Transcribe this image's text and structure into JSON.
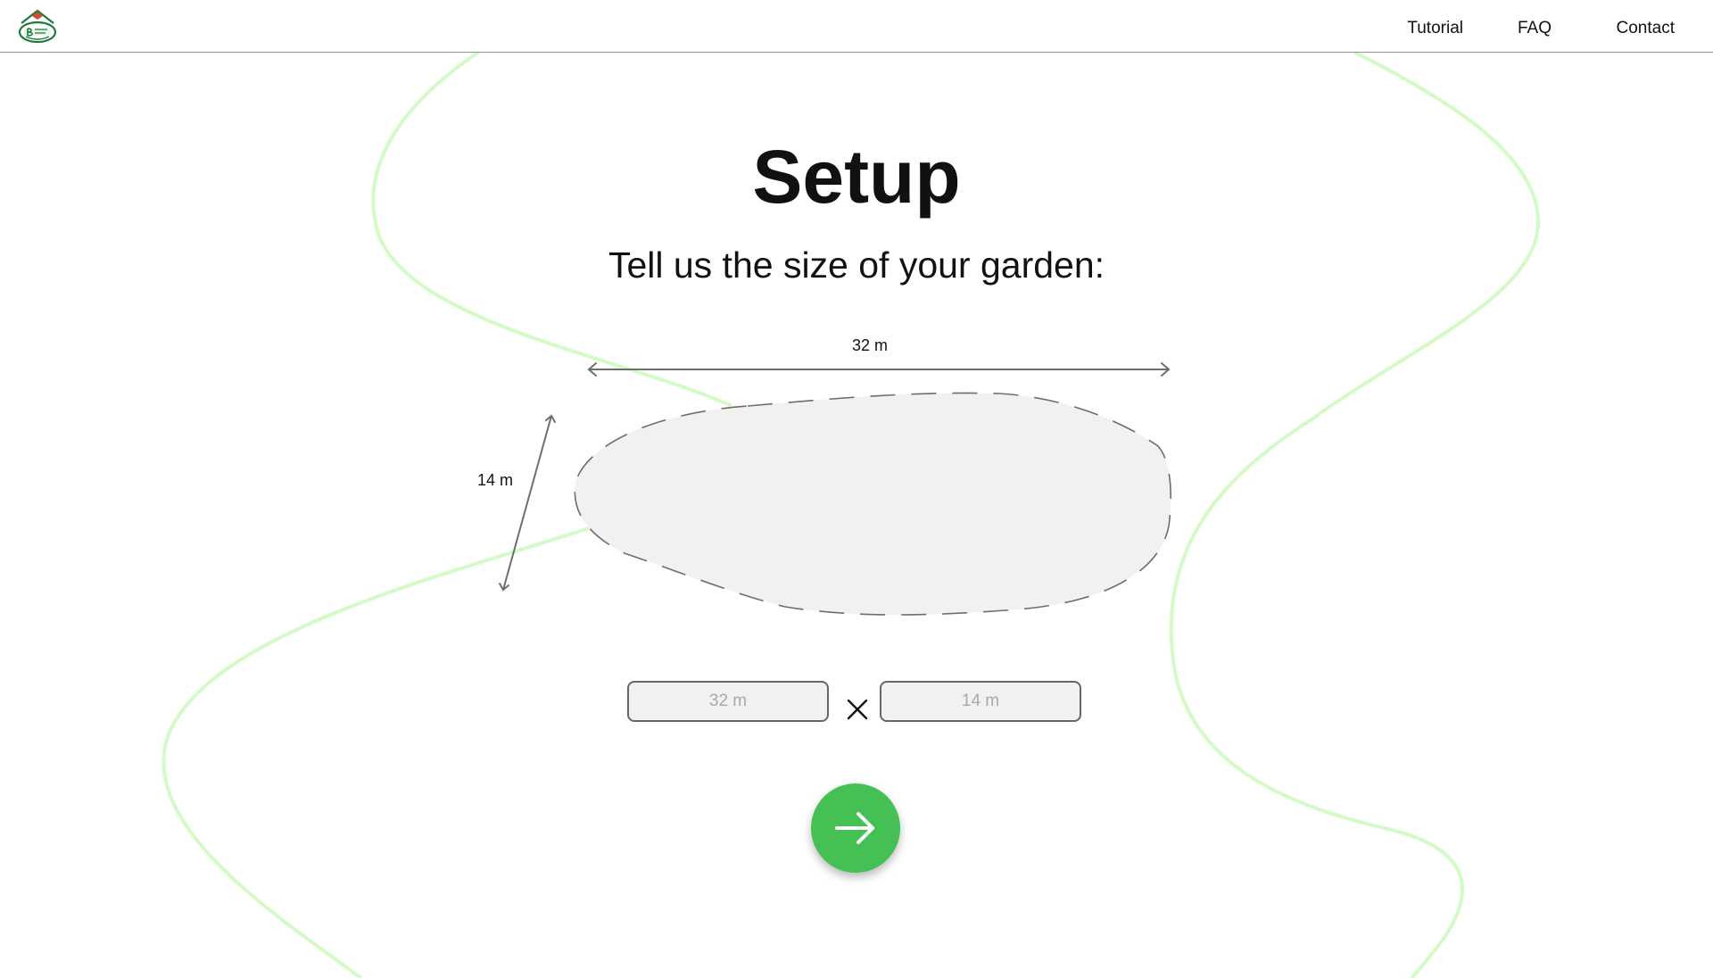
{
  "header": {
    "logo_icon": "bedetti-garden-logo",
    "nav": {
      "tutorial": "Tutorial",
      "faq": "FAQ",
      "contact": "Contact"
    }
  },
  "main": {
    "title": "Setup",
    "subtitle": "Tell us the size of your garden:",
    "diagram": {
      "width_label": "32 m",
      "height_label": "14 m"
    },
    "inputs": {
      "width_placeholder": "32 m",
      "width_value": "",
      "times_icon": "multiply-icon",
      "height_placeholder": "14 m",
      "height_value": ""
    },
    "next_button_icon": "arrow-right-icon"
  },
  "colors": {
    "accent_green": "#45c055",
    "curve_green": "#d4fac6",
    "garden_fill": "#f1f1f1"
  }
}
